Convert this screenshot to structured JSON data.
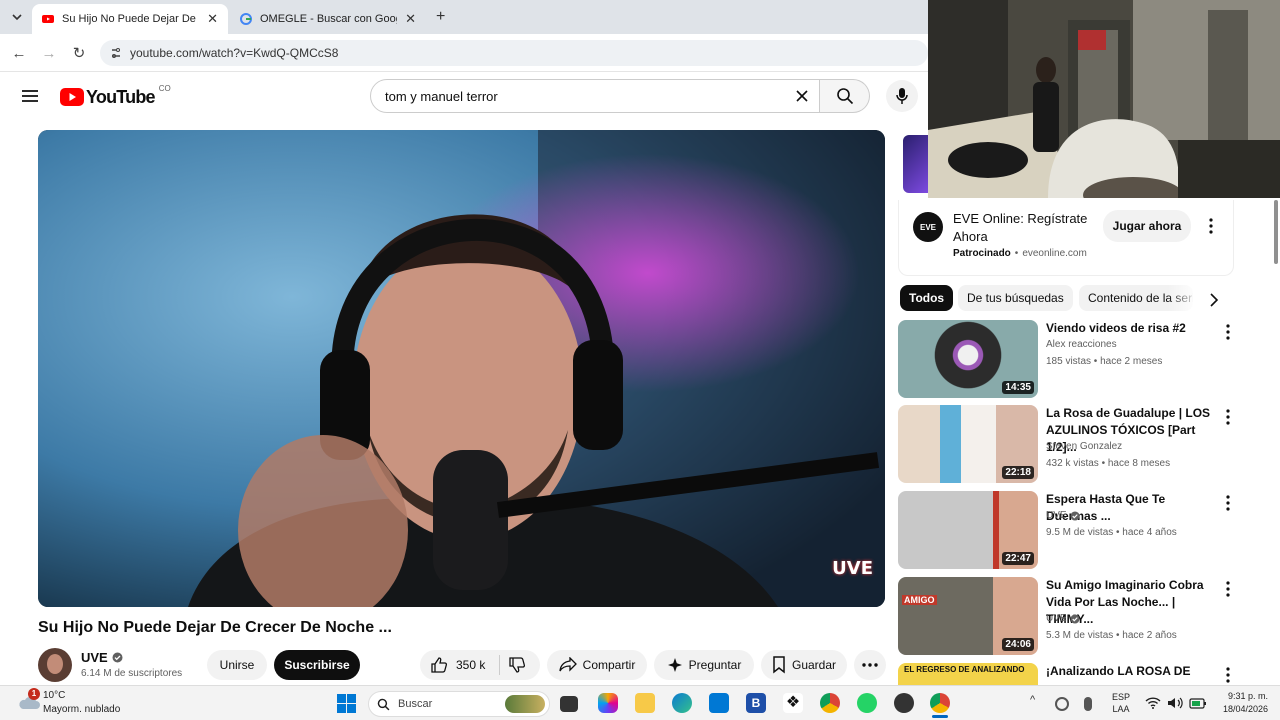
{
  "browser": {
    "tabs": [
      {
        "title": "Su Hijo No Puede Dejar De Crecer De Noche ... - YouTube",
        "active": true
      },
      {
        "title": "OMEGLE - Buscar con Google",
        "active": false
      }
    ],
    "url": "youtube.com/watch?v=KwdQ-QMCcS8"
  },
  "youtube": {
    "logo_text": "YouTube",
    "country": "CO",
    "search_value": "tom y manuel terror"
  },
  "video": {
    "title": "Su Hijo No Puede Dejar De Crecer De Noche ...",
    "watermark": "UVE",
    "channel": {
      "name": "UVE",
      "subscribers": "6.14 M de suscriptores"
    },
    "join_label": "Unirse",
    "subscribe_label": "Suscribirse",
    "likes": "350 k",
    "share_label": "Compartir",
    "ask_label": "Preguntar",
    "save_label": "Guardar"
  },
  "ad": {
    "logo": "EVE",
    "title": "EVE Online: Regístrate Ahora",
    "sponsored": "Patrocinado",
    "domain": "eveonline.com",
    "cta": "Jugar ahora"
  },
  "chips": [
    "Todos",
    "De tus búsquedas",
    "Contenido de la serie"
  ],
  "recommendations": [
    {
      "title": "Viendo videos de risa #2",
      "channel": "Alex reacciones",
      "meta": "185 vistas • hace 2 meses",
      "duration": "14:35",
      "verified": false
    },
    {
      "title": "La Rosa de Guadalupe | LOS AZULINOS TÓXICOS [Part 1/2]...",
      "channel": "Steven Gonzalez",
      "meta": "432 k vistas • hace 8 meses",
      "duration": "22:18",
      "verified": false
    },
    {
      "title": "Espera Hasta Que Te Duermas ...",
      "channel": "UVE",
      "meta": "9.5 M de vistas • hace 4 años",
      "duration": "22:47",
      "verified": true
    },
    {
      "title": "Su Amigo Imaginario Cobra Vida Por Las Noche... | TIMMY...",
      "channel": "UVE",
      "meta": "5.3 M de vistas • hace 2 años",
      "duration": "24:06",
      "verified": true
    },
    {
      "title": "¡Analizando LA ROSA DE",
      "channel": "",
      "meta": "",
      "duration": "",
      "verified": false
    }
  ],
  "thumb_texts": {
    "t2": "AMIGO",
    "t4": "EL REGRESO DE ANALIZANDO"
  },
  "taskbar": {
    "weather_temp": "10°C",
    "weather_desc": "Mayorm. nublado",
    "weather_badge": "1",
    "search_placeholder": "Buscar",
    "lang1": "ESP",
    "lang2": "LAA",
    "time": "9:31 p. m.",
    "date": "18/04/2026"
  }
}
